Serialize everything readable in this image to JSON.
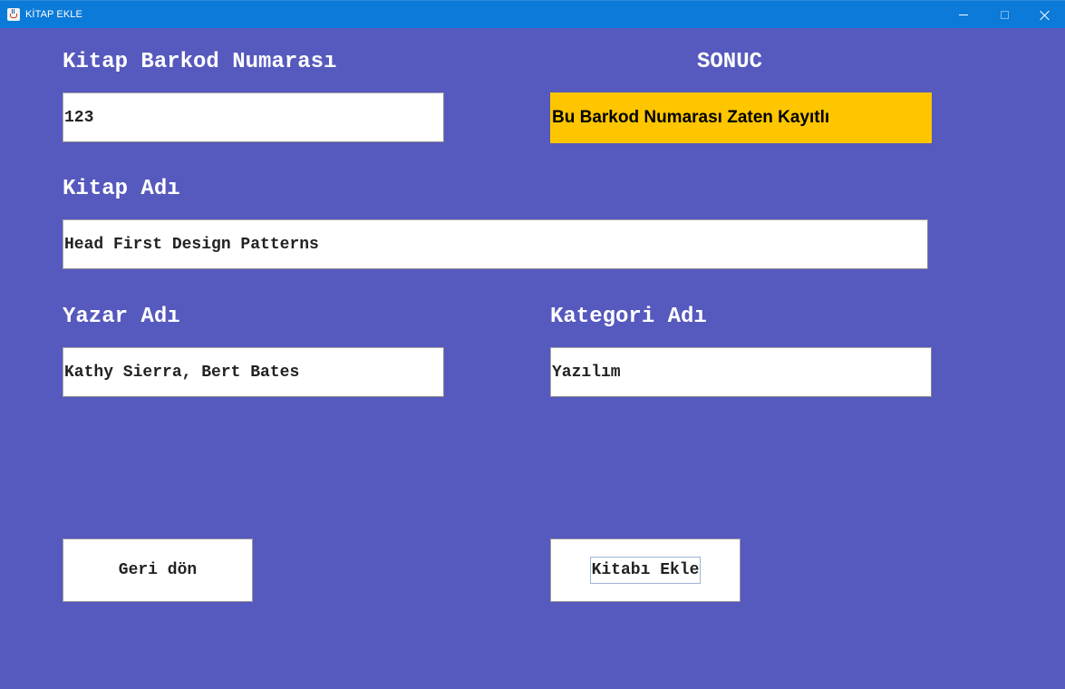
{
  "window": {
    "title": "KİTAP EKLE",
    "icon": "java-cup-icon",
    "controls": [
      "minimize-icon",
      "maximize-icon",
      "close-icon"
    ]
  },
  "form": {
    "barcode": {
      "label": "Kitap Barkod Numarası",
      "value": "123"
    },
    "result": {
      "label": "SONUC",
      "message": "Bu Barkod Numarası Zaten Kayıtlı",
      "color": "#ffc600"
    },
    "book_name": {
      "label": "Kitap Adı",
      "value": "Head First Design Patterns"
    },
    "author": {
      "label": "Yazar Adı",
      "value": "Kathy Sierra, Bert Bates"
    },
    "category": {
      "label": "Kategori Adı",
      "value": "Yazılım"
    }
  },
  "buttons": {
    "back_label": "Geri dön",
    "add_label": "Kitabı Ekle"
  },
  "colors": {
    "background": "#5659bd",
    "titlebar": "#0b7ad8"
  }
}
